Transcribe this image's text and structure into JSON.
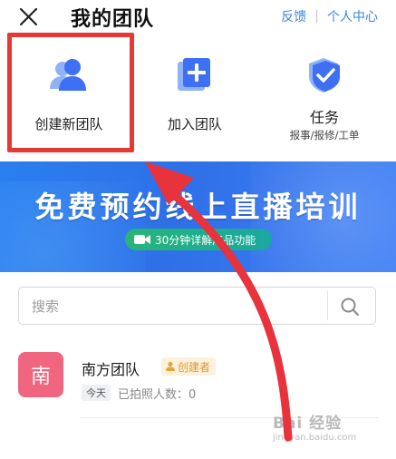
{
  "header": {
    "title": "我的团队",
    "feedback_link": "反馈",
    "separator": "|",
    "user_center_link": "个人中心"
  },
  "actions": [
    {
      "label": "创建新团队",
      "icon": "team-group-icon"
    },
    {
      "label": "加入团队",
      "icon": "add-document-icon"
    },
    {
      "label": "任务",
      "sublabel": "报事/报修/工单",
      "icon": "task-shield-icon"
    }
  ],
  "banner": {
    "title": "免费预约线上直播培训",
    "pill_text": "30分钟详解产品功能"
  },
  "search": {
    "placeholder": "搜索",
    "value": ""
  },
  "team": {
    "avatar_char": "南",
    "name": "南方团队",
    "role_badge": "创建者",
    "time_tag": "今天",
    "photo_count": "已拍照人数：0"
  },
  "watermark": {
    "brand": "Bai 经验",
    "site": "jingyan.baidu.com"
  },
  "colors": {
    "link": "#3b86d8",
    "accent_blue": "#3f6ff2",
    "highlight_red": "#e53935",
    "avatar_pink": "#f0657f",
    "badge_gold": "#d99b2a"
  }
}
